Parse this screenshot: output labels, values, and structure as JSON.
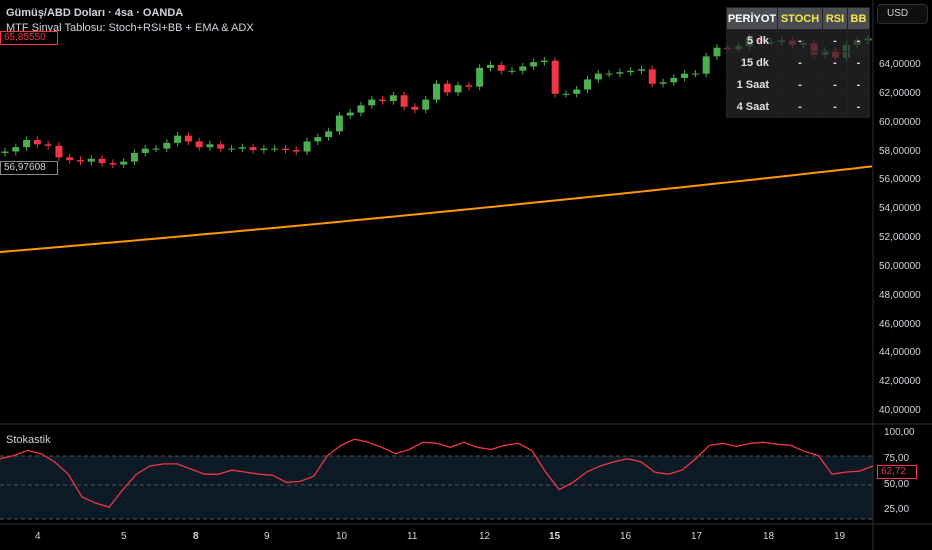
{
  "header": {
    "symbol": "Gümüş/ABD Doları · 4sa · OANDA",
    "indicator": "MTF Sinyal Tablosu: Stoch+RSI+BB + EMA & ADX"
  },
  "currency_button": "USD",
  "table": {
    "headers": [
      "PERİYOT",
      "STOCH",
      "RSI",
      "BB"
    ],
    "rows": [
      [
        "5 dk",
        "-",
        "-",
        "-"
      ],
      [
        "15 dk",
        "-",
        "-",
        "-"
      ],
      [
        "1 Saat",
        "-",
        "-",
        "-"
      ],
      [
        "4 Saat",
        "-",
        "-",
        "-"
      ]
    ]
  },
  "price_axis": [
    "64,00000",
    "62,00000",
    "60,00000",
    "58,00000",
    "56,00000",
    "54,00000",
    "52,00000",
    "50,00000",
    "48,00000",
    "46,00000",
    "44,00000",
    "42,00000",
    "40,00000"
  ],
  "last_price": "65,85550",
  "ema_value": "56,97608",
  "stoch": {
    "title": "Stokastik",
    "axis": [
      "100,00",
      "75,00",
      "50,00",
      "25,00"
    ],
    "value": "62,72"
  },
  "time_axis": [
    {
      "label": "4"
    },
    {
      "label": "5"
    },
    {
      "label": "8",
      "bold": true
    },
    {
      "label": "9"
    },
    {
      "label": "10"
    },
    {
      "label": "11"
    },
    {
      "label": "12"
    },
    {
      "label": "15",
      "bold": true
    },
    {
      "label": "16"
    },
    {
      "label": "17"
    },
    {
      "label": "18"
    },
    {
      "label": "19"
    }
  ],
  "colors": {
    "up": "#4caf50",
    "down": "#f23645",
    "ema": "#ff9800",
    "stoch": "#f23645"
  },
  "chart_data": {
    "candles_close": [
      58.0,
      58.3,
      58.8,
      58.5,
      58.4,
      57.6,
      57.4,
      57.3,
      57.5,
      57.2,
      57.1,
      57.3,
      57.9,
      58.2,
      58.2,
      58.6,
      59.1,
      58.7,
      58.3,
      58.5,
      58.2,
      58.2,
      58.3,
      58.1,
      58.2,
      58.2,
      58.1,
      58.0,
      58.7,
      59.0,
      59.4,
      60.5,
      60.7,
      61.2,
      61.6,
      61.5,
      61.9,
      61.1,
      60.9,
      61.6,
      62.7,
      62.1,
      62.6,
      62.5,
      63.8,
      64.0,
      63.6,
      63.6,
      63.9,
      64.2,
      64.3,
      62.0,
      62.0,
      62.3,
      63.0,
      63.4,
      63.4,
      63.5,
      63.6,
      63.7,
      62.7,
      62.8,
      63.1,
      63.4,
      63.4,
      64.6,
      65.2,
      65.1,
      65.3,
      65.9,
      65.6,
      65.6,
      65.7,
      65.4,
      65.5,
      64.7,
      65.0,
      64.5,
      65.4,
      65.7,
      65.8555
    ],
    "ema": {
      "start": 51.03,
      "end": 56.97608
    },
    "stoch": [
      75,
      78,
      83,
      80,
      72,
      60,
      38,
      32,
      28,
      45,
      60,
      68,
      70,
      70,
      65,
      60,
      60,
      64,
      62,
      60,
      59,
      52,
      53,
      58,
      78,
      88,
      94,
      91,
      86,
      80,
      84,
      91,
      90,
      86,
      91,
      86,
      84,
      88,
      90,
      83,
      62,
      45,
      52,
      62,
      68,
      72,
      75,
      72,
      62,
      60,
      64,
      75,
      88,
      90,
      87,
      90,
      91,
      89,
      88,
      82,
      78,
      60,
      62,
      63,
      68
    ]
  }
}
